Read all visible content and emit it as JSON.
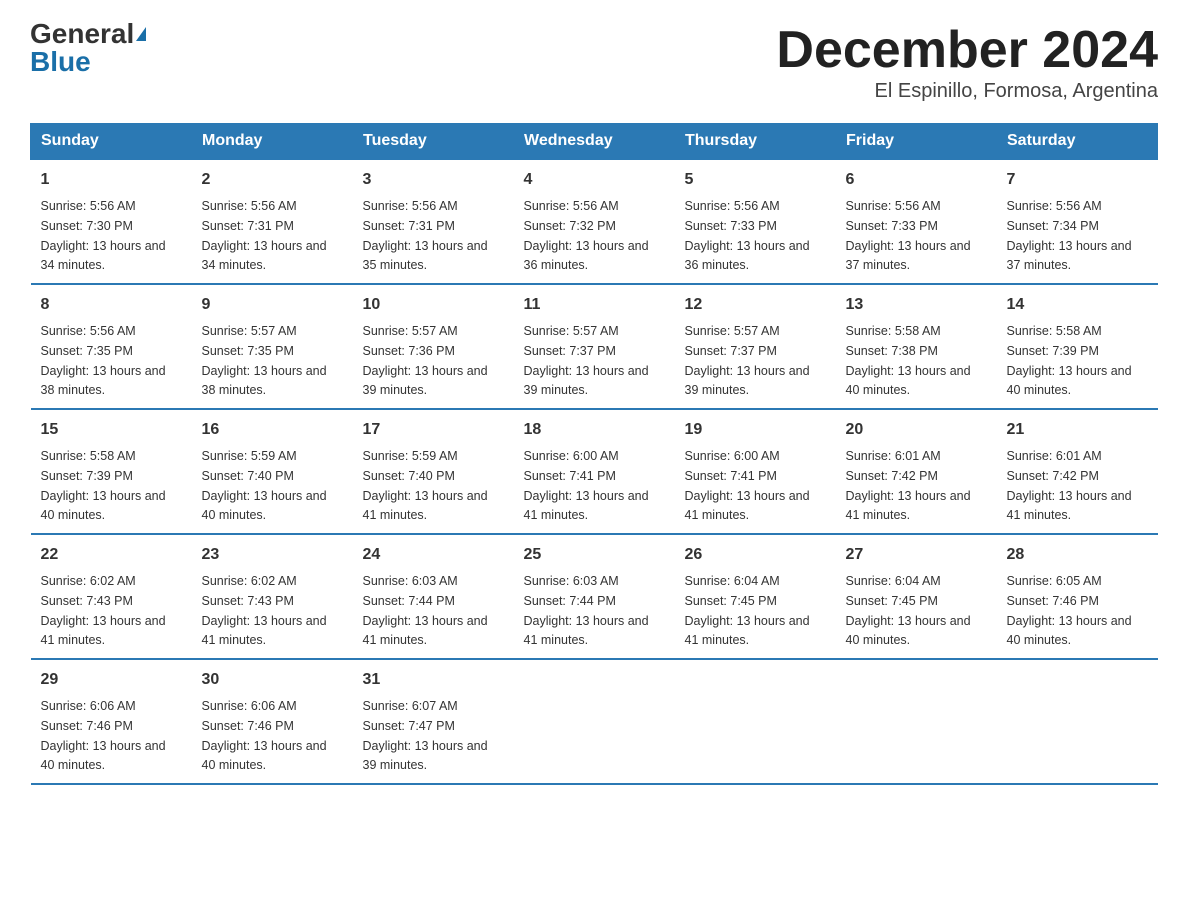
{
  "header": {
    "logo_general": "General",
    "logo_blue": "Blue",
    "month_title": "December 2024",
    "location": "El Espinillo, Formosa, Argentina"
  },
  "days_of_week": [
    "Sunday",
    "Monday",
    "Tuesday",
    "Wednesday",
    "Thursday",
    "Friday",
    "Saturday"
  ],
  "weeks": [
    [
      {
        "day": "1",
        "sunrise": "5:56 AM",
        "sunset": "7:30 PM",
        "daylight": "13 hours and 34 minutes."
      },
      {
        "day": "2",
        "sunrise": "5:56 AM",
        "sunset": "7:31 PM",
        "daylight": "13 hours and 34 minutes."
      },
      {
        "day": "3",
        "sunrise": "5:56 AM",
        "sunset": "7:31 PM",
        "daylight": "13 hours and 35 minutes."
      },
      {
        "day": "4",
        "sunrise": "5:56 AM",
        "sunset": "7:32 PM",
        "daylight": "13 hours and 36 minutes."
      },
      {
        "day": "5",
        "sunrise": "5:56 AM",
        "sunset": "7:33 PM",
        "daylight": "13 hours and 36 minutes."
      },
      {
        "day": "6",
        "sunrise": "5:56 AM",
        "sunset": "7:33 PM",
        "daylight": "13 hours and 37 minutes."
      },
      {
        "day": "7",
        "sunrise": "5:56 AM",
        "sunset": "7:34 PM",
        "daylight": "13 hours and 37 minutes."
      }
    ],
    [
      {
        "day": "8",
        "sunrise": "5:56 AM",
        "sunset": "7:35 PM",
        "daylight": "13 hours and 38 minutes."
      },
      {
        "day": "9",
        "sunrise": "5:57 AM",
        "sunset": "7:35 PM",
        "daylight": "13 hours and 38 minutes."
      },
      {
        "day": "10",
        "sunrise": "5:57 AM",
        "sunset": "7:36 PM",
        "daylight": "13 hours and 39 minutes."
      },
      {
        "day": "11",
        "sunrise": "5:57 AM",
        "sunset": "7:37 PM",
        "daylight": "13 hours and 39 minutes."
      },
      {
        "day": "12",
        "sunrise": "5:57 AM",
        "sunset": "7:37 PM",
        "daylight": "13 hours and 39 minutes."
      },
      {
        "day": "13",
        "sunrise": "5:58 AM",
        "sunset": "7:38 PM",
        "daylight": "13 hours and 40 minutes."
      },
      {
        "day": "14",
        "sunrise": "5:58 AM",
        "sunset": "7:39 PM",
        "daylight": "13 hours and 40 minutes."
      }
    ],
    [
      {
        "day": "15",
        "sunrise": "5:58 AM",
        "sunset": "7:39 PM",
        "daylight": "13 hours and 40 minutes."
      },
      {
        "day": "16",
        "sunrise": "5:59 AM",
        "sunset": "7:40 PM",
        "daylight": "13 hours and 40 minutes."
      },
      {
        "day": "17",
        "sunrise": "5:59 AM",
        "sunset": "7:40 PM",
        "daylight": "13 hours and 41 minutes."
      },
      {
        "day": "18",
        "sunrise": "6:00 AM",
        "sunset": "7:41 PM",
        "daylight": "13 hours and 41 minutes."
      },
      {
        "day": "19",
        "sunrise": "6:00 AM",
        "sunset": "7:41 PM",
        "daylight": "13 hours and 41 minutes."
      },
      {
        "day": "20",
        "sunrise": "6:01 AM",
        "sunset": "7:42 PM",
        "daylight": "13 hours and 41 minutes."
      },
      {
        "day": "21",
        "sunrise": "6:01 AM",
        "sunset": "7:42 PM",
        "daylight": "13 hours and 41 minutes."
      }
    ],
    [
      {
        "day": "22",
        "sunrise": "6:02 AM",
        "sunset": "7:43 PM",
        "daylight": "13 hours and 41 minutes."
      },
      {
        "day": "23",
        "sunrise": "6:02 AM",
        "sunset": "7:43 PM",
        "daylight": "13 hours and 41 minutes."
      },
      {
        "day": "24",
        "sunrise": "6:03 AM",
        "sunset": "7:44 PM",
        "daylight": "13 hours and 41 minutes."
      },
      {
        "day": "25",
        "sunrise": "6:03 AM",
        "sunset": "7:44 PM",
        "daylight": "13 hours and 41 minutes."
      },
      {
        "day": "26",
        "sunrise": "6:04 AM",
        "sunset": "7:45 PM",
        "daylight": "13 hours and 41 minutes."
      },
      {
        "day": "27",
        "sunrise": "6:04 AM",
        "sunset": "7:45 PM",
        "daylight": "13 hours and 40 minutes."
      },
      {
        "day": "28",
        "sunrise": "6:05 AM",
        "sunset": "7:46 PM",
        "daylight": "13 hours and 40 minutes."
      }
    ],
    [
      {
        "day": "29",
        "sunrise": "6:06 AM",
        "sunset": "7:46 PM",
        "daylight": "13 hours and 40 minutes."
      },
      {
        "day": "30",
        "sunrise": "6:06 AM",
        "sunset": "7:46 PM",
        "daylight": "13 hours and 40 minutes."
      },
      {
        "day": "31",
        "sunrise": "6:07 AM",
        "sunset": "7:47 PM",
        "daylight": "13 hours and 39 minutes."
      },
      null,
      null,
      null,
      null
    ]
  ]
}
